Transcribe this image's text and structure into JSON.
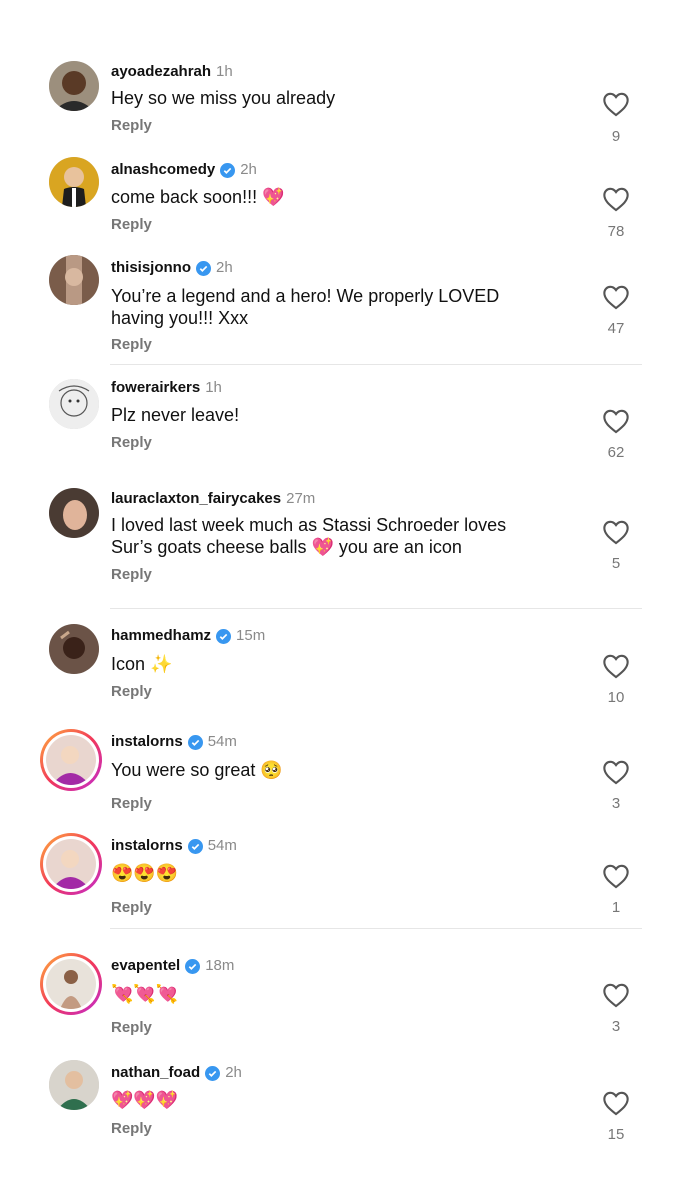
{
  "comments": [
    {
      "username": "ayoadezahrah",
      "verified": false,
      "time": "1h",
      "line1": "Hey so we miss you already",
      "line2": "",
      "reply": "Reply",
      "likes": "9"
    },
    {
      "username": "alnashcomedy",
      "verified": true,
      "time": "2h",
      "line1": "come back soon!!! 💖",
      "line2": "",
      "reply": "Reply",
      "likes": "78"
    },
    {
      "username": "thisisjonno",
      "verified": true,
      "time": "2h",
      "line1": "You’re a legend and a hero! We properly LOVED",
      "line2": "having you!!! Xxx",
      "reply": "Reply",
      "likes": "47"
    },
    {
      "username": "fowerairkers",
      "verified": false,
      "time": "1h",
      "line1": "Plz never leave!",
      "line2": "",
      "reply": "Reply",
      "likes": "62"
    },
    {
      "username": "lauraclaxton_fairycakes",
      "verified": false,
      "time": "27m",
      "line1": "I loved last week much as Stassi Schroeder loves",
      "line2": "Sur’s goats cheese balls 💖 you are an icon",
      "reply": "Reply",
      "likes": "5"
    },
    {
      "username": "hammedhamz",
      "verified": true,
      "time": "15m",
      "line1": "Icon ✨",
      "line2": "",
      "reply": "Reply",
      "likes": "10"
    },
    {
      "username": "instalorns",
      "verified": true,
      "time": "54m",
      "line1": "You were so great 🥺",
      "line2": "",
      "reply": "Reply",
      "likes": "3"
    },
    {
      "username": "instalorns",
      "verified": true,
      "time": "54m",
      "line1": "😍😍😍",
      "line2": "",
      "reply": "Reply",
      "likes": "1"
    },
    {
      "username": "evapentel",
      "verified": true,
      "time": "18m",
      "line1": "💘💘💘",
      "line2": "",
      "reply": "Reply",
      "likes": "3"
    },
    {
      "username": "nathan_foad",
      "verified": true,
      "time": "2h",
      "line1": "💖💖💖",
      "line2": "",
      "reply": "Reply",
      "likes": "15"
    }
  ],
  "icons": {
    "like": "heart-outline-icon",
    "verified": "verified-badge-icon"
  },
  "colors": {
    "verified": "#3897f0",
    "muted": "#777777",
    "story_ring": "#e1306c"
  }
}
